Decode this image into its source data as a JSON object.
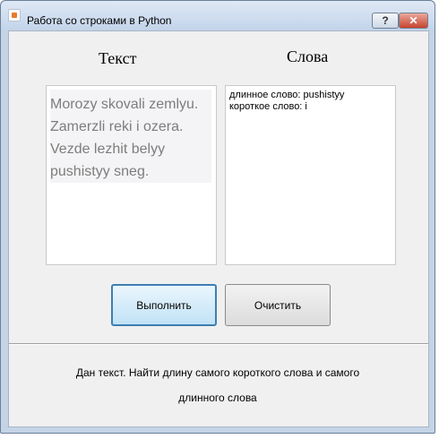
{
  "window": {
    "title": "Работа со строками в Python",
    "help_label": "?",
    "close_label": "✕"
  },
  "labels": {
    "text": "Текст",
    "words": "Слова"
  },
  "text_input": {
    "value": "Morozy skovali zemlyu.\nZamerzli reki i ozera.\nVezde lezhit belyy\npushistyy sneg."
  },
  "words_output": {
    "long_word": "длинное слово: pushistyy",
    "short_word": "короткое слово: i"
  },
  "buttons": {
    "run": "Выполнить",
    "clear": "Очистить"
  },
  "task": {
    "line1": "Дан текст. Найти длину самого короткого слова и самого",
    "line2": "длинного слова"
  },
  "colors": {
    "run_border": "#3c7fb1",
    "close_button": "#c7432f"
  }
}
